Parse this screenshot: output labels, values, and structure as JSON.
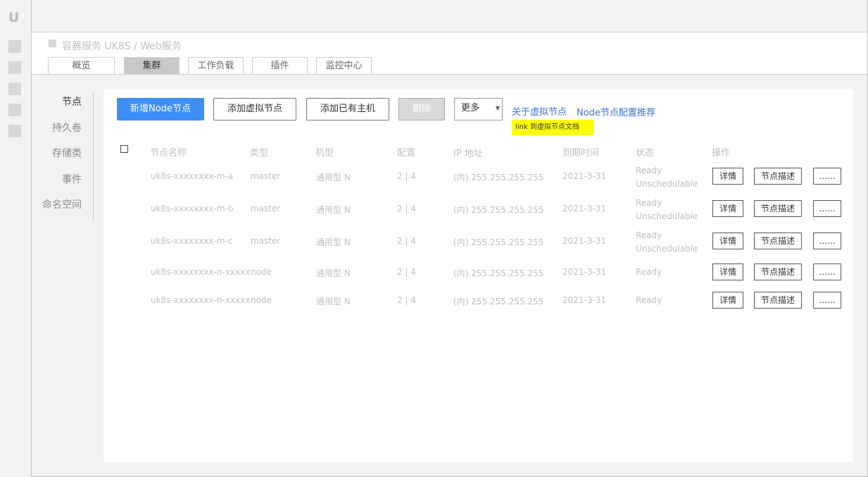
{
  "rail": {
    "logo": "U"
  },
  "breadcrumb": {
    "text": "容器服务 UK8S / Web服务"
  },
  "tabs": [
    {
      "label": "概览"
    },
    {
      "label": "集群"
    },
    {
      "label": "工作负载"
    },
    {
      "label": "插件"
    },
    {
      "label": "监控中心"
    }
  ],
  "subnav": [
    {
      "label": "节点"
    },
    {
      "label": "持久卷"
    },
    {
      "label": "存储类"
    },
    {
      "label": "事件"
    },
    {
      "label": "命名空间"
    }
  ],
  "toolbar": {
    "add_node": "新增Node节点",
    "add_virtual": "添加虚拟节点",
    "add_existing": "添加已有主机",
    "delete": "删除",
    "more": "更多",
    "more_caret": "▼",
    "link_virtual": "关于虚拟节点",
    "link_config": "Node节点配置推荐",
    "note": "link 到虚拟节点文档"
  },
  "table": {
    "headers": [
      "节点名称",
      "类型",
      "机型",
      "配置",
      "IP 地址",
      "到期时间",
      "状态",
      "操作"
    ],
    "rows": [
      {
        "name": "uk8s-xxxxxxxx-m-a",
        "type": "master",
        "model": "通用型 N",
        "config": "2 | 4",
        "ip": "(内) 255.255.255.255",
        "expire": "2021-3-31",
        "status1": "Ready",
        "status2": "Unschedulable"
      },
      {
        "name": "uk8s-xxxxxxxx-m-b",
        "type": "master",
        "model": "通用型 N",
        "config": "2 | 4",
        "ip": "(内) 255.255.255.255",
        "expire": "2021-3-31",
        "status1": "Ready",
        "status2": "Unschedulable"
      },
      {
        "name": "uk8s-xxxxxxxx-m-c",
        "type": "master",
        "model": "通用型 N",
        "config": "2 | 4",
        "ip": "(内) 255.255.255.255",
        "expire": "2021-3-31",
        "status1": "Ready",
        "status2": "Unschedulable"
      },
      {
        "name": "uk8s-xxxxxxxx-n-xxxxx",
        "type": "node",
        "model": "通用型 N",
        "config": "2 | 4",
        "ip": "(内) 255.255.255.255",
        "expire": "2021-3-31",
        "status1": "Ready",
        "status2": ""
      },
      {
        "name": "uk8s-xxxxxxxx-n-xxxxx",
        "type": "node",
        "model": "通用型 N",
        "config": "2 | 4",
        "ip": "(内) 255.255.255.255",
        "expire": "2021-3-31",
        "status1": "Ready",
        "status2": ""
      }
    ],
    "actions": {
      "detail": "详情",
      "describe": "节点描述",
      "more": "......"
    }
  }
}
